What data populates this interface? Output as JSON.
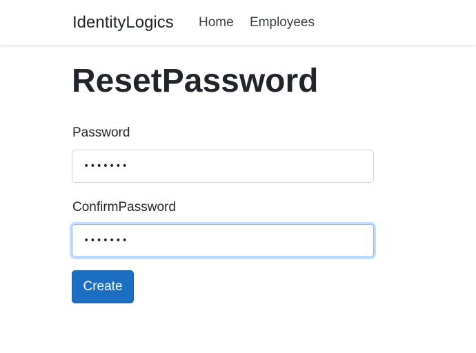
{
  "navbar": {
    "brand": "IdentityLogics",
    "links": [
      "Home",
      "Employees"
    ]
  },
  "page": {
    "title": "ResetPassword"
  },
  "form": {
    "password_label": "Password",
    "password_value": "1234567",
    "confirm_label": "ConfirmPassword",
    "confirm_value": "1234567",
    "submit_label": "Create"
  },
  "colors": {
    "primary_button": "#1b6ec2",
    "focus_border": "#86b7fe"
  }
}
